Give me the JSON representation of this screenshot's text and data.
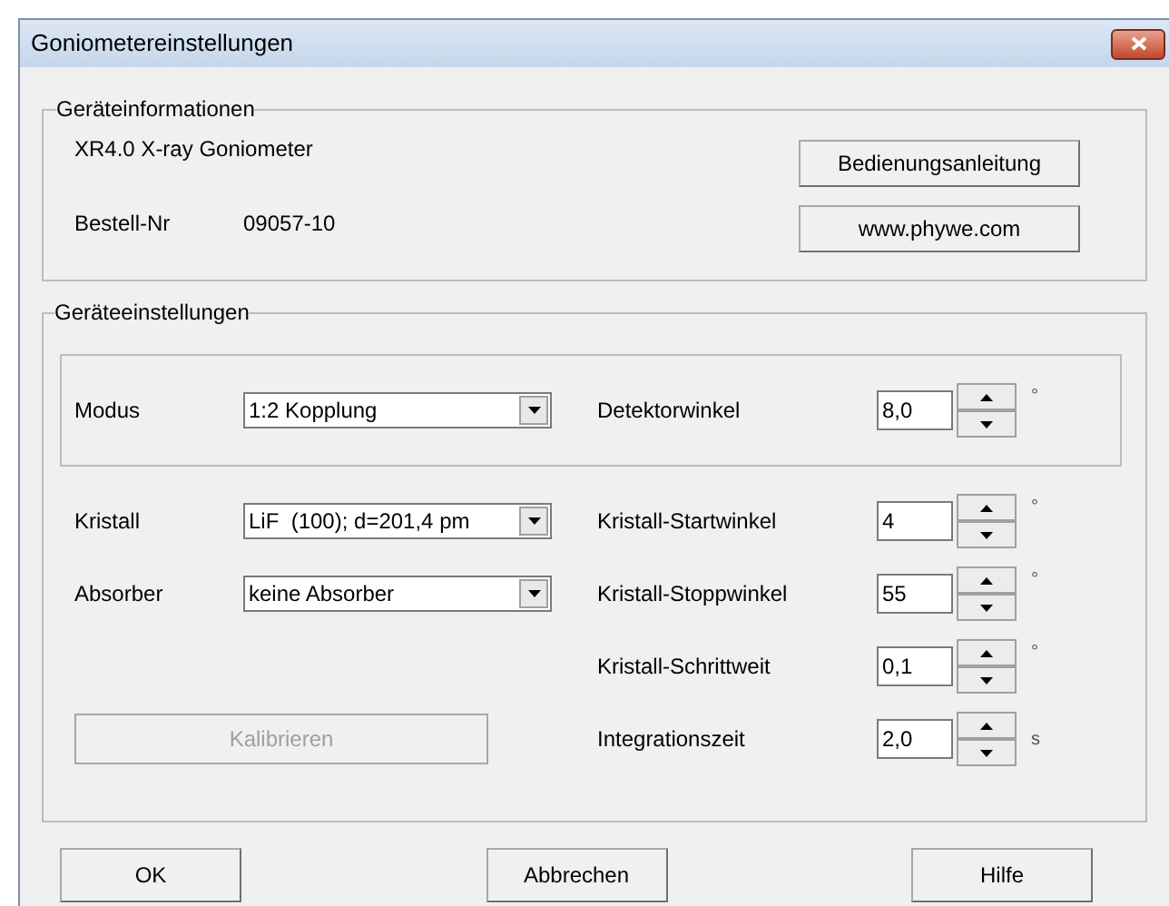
{
  "window": {
    "title": "Goniometereinstellungen"
  },
  "device_info": {
    "title": "Geräteinformationen",
    "device": "XR4.0 X-ray Goniometer",
    "order_label": "Bestell-Nr",
    "order_number": "09057-10",
    "buttons": [
      "Bedienungsanleitung",
      "www.phywe.com"
    ]
  },
  "settings": {
    "title": "Geräteeinstellungen",
    "selects": [
      {
        "label": "Modus",
        "value": "1:2 Kopplung"
      },
      {
        "label": "Kristall",
        "value": "LiF  (100); d=201,4 pm"
      },
      {
        "label": "Absorber",
        "value": "keine Absorber"
      }
    ],
    "spinners": [
      {
        "label": "Detektorwinkel",
        "value": "8,0",
        "unit": "°"
      },
      {
        "label": "Kristall-Startwinkel",
        "value": "4",
        "unit": "°"
      },
      {
        "label": "Kristall-Stoppwinkel",
        "value": "55",
        "unit": "°"
      },
      {
        "label": "Kristall-Schrittweit",
        "value": "0,1",
        "unit": "°"
      },
      {
        "label": "Integrationszeit",
        "value": "2,0",
        "unit": "s"
      }
    ],
    "calibrate": {
      "label": "Kalibrieren",
      "disabled": true
    }
  },
  "buttons": [
    "OK",
    "Abbrechen",
    "Hilfe"
  ]
}
